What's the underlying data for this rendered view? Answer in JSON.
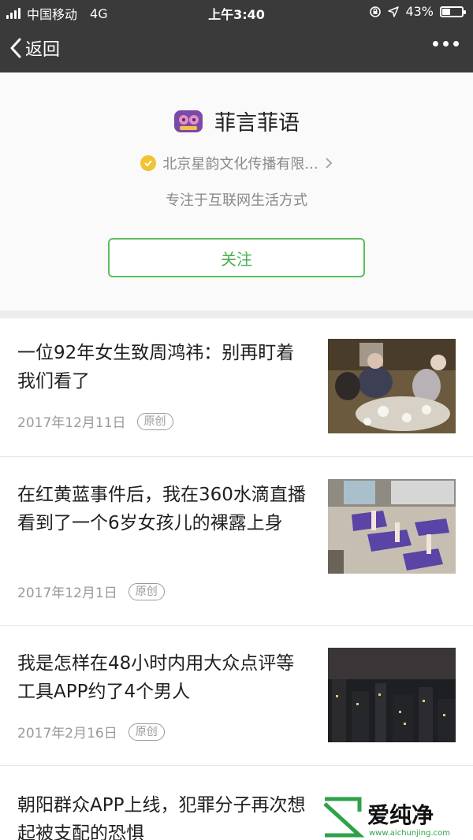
{
  "status_bar": {
    "carrier": "中国移动",
    "network": "4G",
    "time": "上午3:40",
    "battery_text": "43%",
    "battery_level": 0.43
  },
  "nav": {
    "back_label": "返回",
    "more_icon": "more-horizontal-icon"
  },
  "profile": {
    "account_name": "菲言菲语",
    "verified_org": "北京星韵文化传播有限...",
    "description": "专注于互联网生活方式",
    "follow_label": "关注"
  },
  "articles": [
    {
      "title": "一位92年女生致周鸿祎：别再盯着我们看了",
      "date": "2017年12月11日",
      "tag": "原创"
    },
    {
      "title": "在红黄蓝事件后，我在360水滴直播看到了一个6岁女孩儿的裸露上身",
      "date": "2017年12月1日",
      "tag": "原创"
    },
    {
      "title": "我是怎样在48小时内用大众点评等工具APP约了4个男人",
      "date": "2017年2月16日",
      "tag": "原创"
    },
    {
      "title": "朝阳群众APP上线，犯罪分子再次想起被支配的恐惧"
    }
  ],
  "watermark": {
    "brand": "爱纯净",
    "url": "www.aichunjing.com"
  },
  "colors": {
    "topbar": "#3a3a3a",
    "follow_green": "#4caf50",
    "verified_gold": "#f1c232"
  }
}
